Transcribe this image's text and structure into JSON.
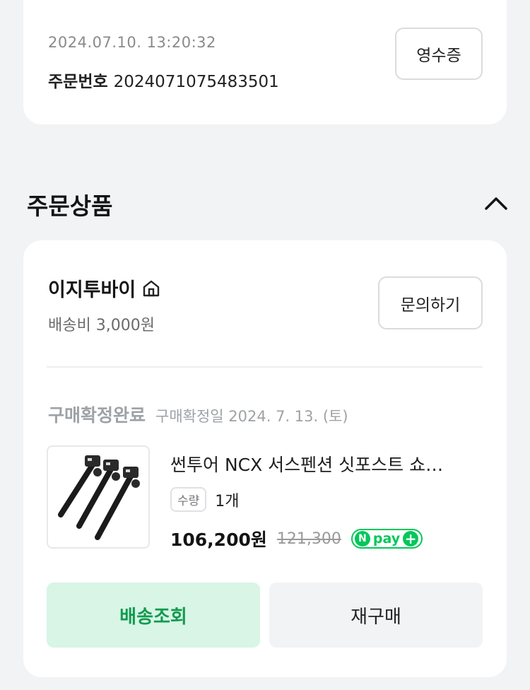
{
  "order": {
    "datetime": "2024.07.10. 13:20:32",
    "number_label": "주문번호",
    "number": "2024071075483501",
    "receipt_label": "영수증"
  },
  "section": {
    "title": "주문상품",
    "collapse_icon": "chevron-up-icon"
  },
  "seller": {
    "name": "이지투바이",
    "store_icon": "home-icon",
    "shipping_fee": "배송비 3,000원",
    "inquiry_label": "문의하기"
  },
  "product": {
    "status": "구매확정완료",
    "confirm_date": "구매확정일 2024. 7. 13. (토)",
    "name": "썬투어 NCX 서스펜션 싯포스트 쇼…",
    "qty_label": "수량",
    "qty_value": "1개",
    "price": "106,200원",
    "original_price": "121,300",
    "npay_label": "pay",
    "npay_n": "N",
    "npay_plus": "+"
  },
  "actions": {
    "track_label": "배송조회",
    "rebuy_label": "재구매"
  },
  "colors": {
    "background": "#f1f3f5",
    "accent_green": "#03c75a",
    "track_bg": "#d8f5e6",
    "track_text": "#139a4f"
  }
}
